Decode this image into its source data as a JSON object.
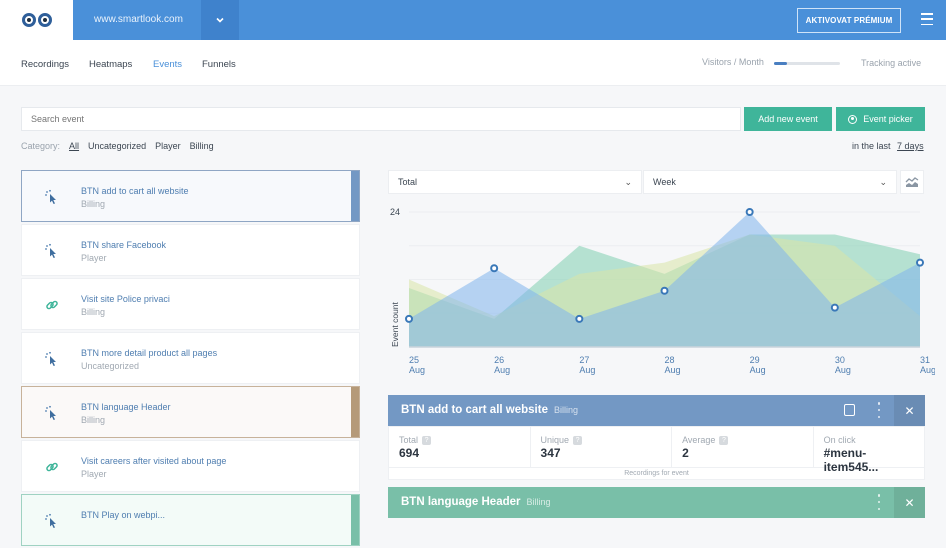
{
  "header": {
    "site": "www.smartlook.com",
    "premium_button": "AKTIVOVAT PRÉMIUM",
    "colors": {
      "primary": "#4a90d9",
      "accent_green": "#3fb59a"
    }
  },
  "nav": {
    "tabs": [
      {
        "label": "Recordings",
        "active": false
      },
      {
        "label": "Heatmaps",
        "active": false
      },
      {
        "label": "Events",
        "active": true
      },
      {
        "label": "Funnels",
        "active": false
      }
    ],
    "visitors_label": "Visitors / Month",
    "visitors_usage": 0.2,
    "tracking_status": "Tracking active"
  },
  "toolbar": {
    "search_placeholder": "Search event",
    "add_button": "Add new event",
    "picker_button": "Event picker",
    "category_label": "Category:",
    "categories": [
      "All",
      "Uncategorized",
      "Player",
      "Billing"
    ],
    "active_category": "All",
    "range_prefix": "in the last",
    "range_value": "7 days"
  },
  "events": [
    {
      "title": "BTN add to cart all website",
      "category": "Billing",
      "icon": "cursor-click-icon",
      "selected": "blue"
    },
    {
      "title": "BTN share Facebook",
      "category": "Player",
      "icon": "cursor-click-icon",
      "selected": ""
    },
    {
      "title": "Visit site Police privaci",
      "category": "Billing",
      "icon": "link-icon",
      "selected": ""
    },
    {
      "title": "BTN more detail product all pages",
      "category": "Uncategorized",
      "icon": "cursor-click-icon",
      "selected": ""
    },
    {
      "title": "BTN language Header",
      "category": "Billing",
      "icon": "cursor-click-icon",
      "selected": "brown"
    },
    {
      "title": "Visit careers after visited about page",
      "category": "Player",
      "icon": "link-icon",
      "selected": ""
    },
    {
      "title": "BTN Play on webpi...",
      "category": "",
      "icon": "cursor-click-icon",
      "selected": "green"
    }
  ],
  "chart_controls": {
    "metric": "Total",
    "period": "Week"
  },
  "chart_data": {
    "type": "area",
    "ylabel": "Event count",
    "xlabel": "",
    "ylim": [
      0,
      24
    ],
    "yticks_labeled": [
      "24"
    ],
    "grid": true,
    "categories": [
      [
        "25",
        "Aug"
      ],
      [
        "26",
        "Aug"
      ],
      [
        "27",
        "Aug"
      ],
      [
        "28",
        "Aug"
      ],
      [
        "29",
        "Aug"
      ],
      [
        "30",
        "Aug"
      ],
      [
        "31",
        "Aug"
      ]
    ],
    "series": [
      {
        "name": "BTN language Header",
        "color": "#7fcfb0",
        "values": [
          10.5,
          5,
          18,
          13,
          20,
          20,
          16.5
        ]
      },
      {
        "name": "BTN Play on webpi...",
        "color": "#d9e6a8",
        "values": [
          12,
          5.5,
          13,
          15,
          20,
          18,
          5.5
        ]
      },
      {
        "name": "BTN add to cart all website",
        "color": "#7fb4ec",
        "values": [
          5,
          14,
          5,
          10,
          24,
          7,
          15
        ],
        "markers": true
      }
    ]
  },
  "cards": [
    {
      "title": "BTN add to cart all website",
      "category": "Billing",
      "color": "#7398c4",
      "stats": [
        {
          "label": "Total",
          "value": "694",
          "help": true
        },
        {
          "label": "Unique",
          "value": "347",
          "help": true
        },
        {
          "label": "Average",
          "value": "2",
          "help": true
        },
        {
          "label": "On click",
          "value": "#menu-item545...",
          "help": false
        }
      ],
      "recordings_link": "Recordings for event"
    },
    {
      "title": "BTN language Header",
      "category": "Billing",
      "color": "#79bfa8"
    }
  ]
}
